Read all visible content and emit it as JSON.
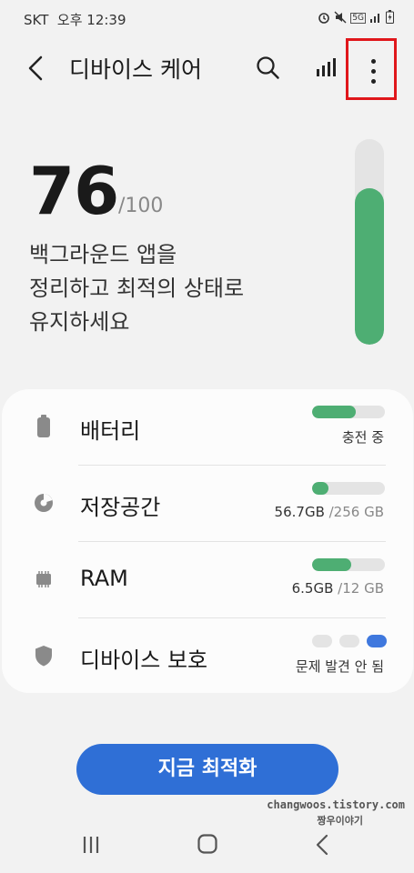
{
  "status_bar": {
    "carrier": "SKT",
    "time": "오후 12:39",
    "network": "5G"
  },
  "appbar": {
    "title": "디바이스 케어"
  },
  "score": {
    "value": "76",
    "max_label": "/100",
    "level": 0.76,
    "message": "백그라운드 앱을\n정리하고 최적의 상태로\n유지하세요"
  },
  "items": [
    {
      "label": "배터리",
      "sub": "충전 중",
      "level": 0.6
    },
    {
      "label": "저장공간",
      "sub_value": "56.7GB",
      "sub_total": " /256 GB",
      "level": 0.22
    },
    {
      "label": "RAM",
      "sub_value": "6.5GB",
      "sub_total": " /12 GB",
      "level": 0.54
    },
    {
      "label": "디바이스 보호",
      "sub": "문제 발견 안 됨",
      "active_dot": 3
    }
  ],
  "optimize_button": "지금 최적화",
  "watermark": {
    "url": "changwoos.tistory.com",
    "name": "짱우이야기"
  },
  "colors": {
    "accent_green": "#4eae73",
    "button_blue": "#2f6fd6",
    "highlight_red": "#e0171b",
    "protect_blue": "#3f78de"
  }
}
